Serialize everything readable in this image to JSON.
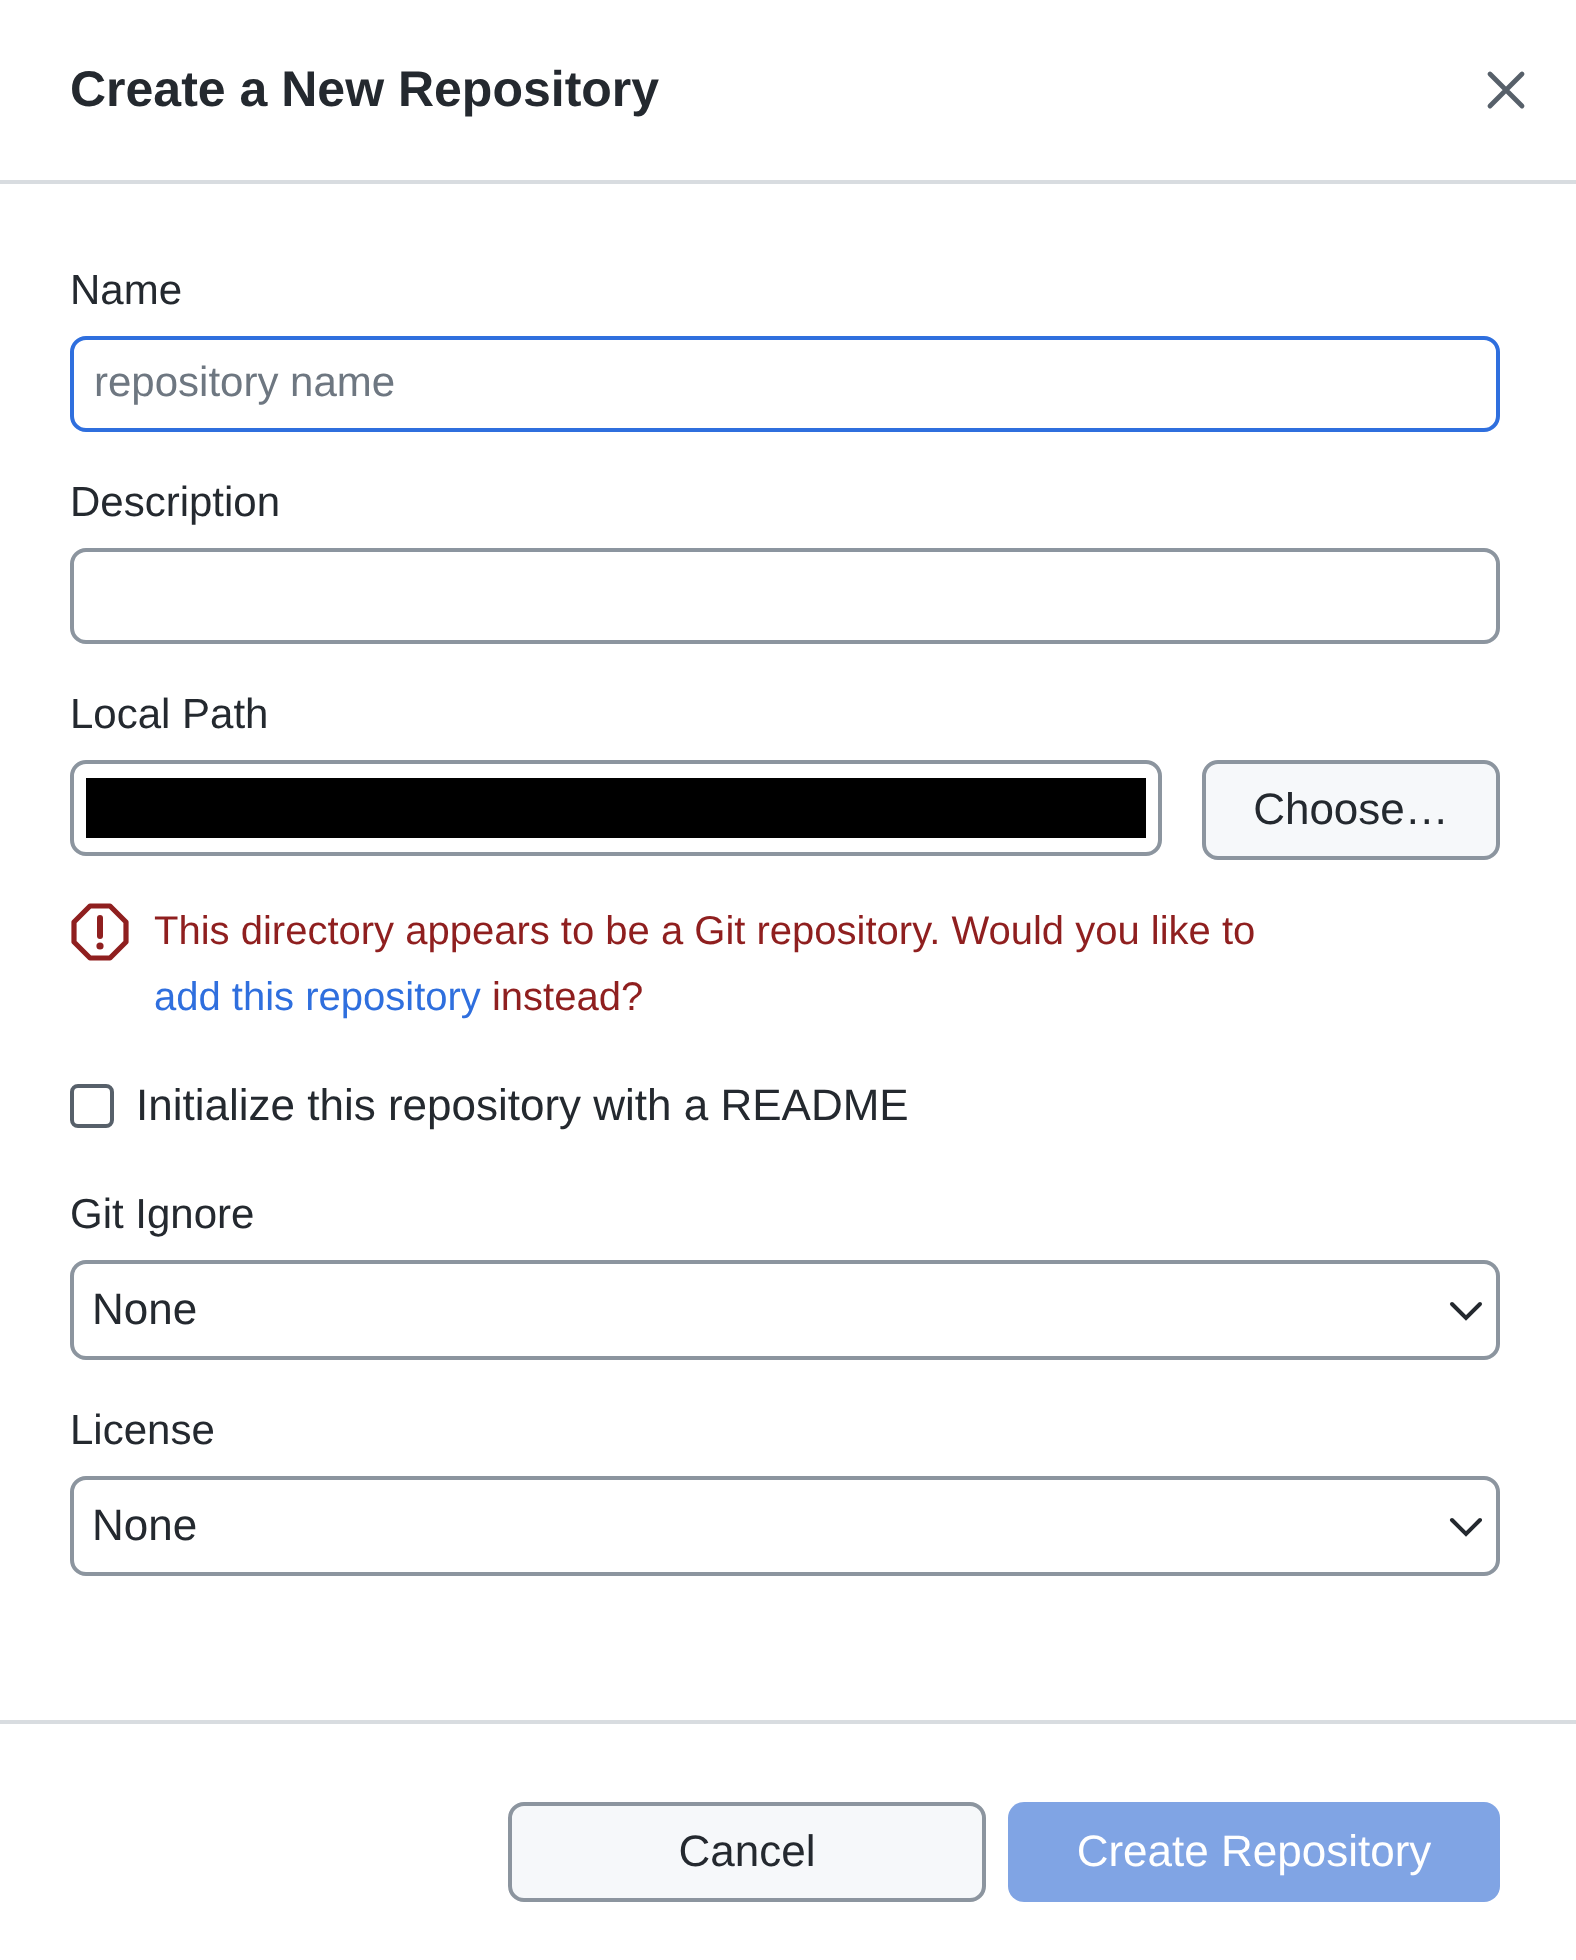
{
  "dialog": {
    "title": "Create a New Repository"
  },
  "fields": [
    {
      "label": "Name",
      "placeholder": "repository name",
      "focused": true
    },
    {
      "label": "Description",
      "focused": false
    }
  ],
  "local_path": {
    "label": "Local Path",
    "redacted": true,
    "button": "Choose…"
  },
  "warning": {
    "before": "This directory appears to be a Git repository. Would you like to ",
    "link": "add this repository",
    "after": " instead?"
  },
  "readme": {
    "label": "Initialize this repository with a README",
    "checked": false
  },
  "selects": [
    {
      "label": "Git Ignore",
      "value": "None"
    },
    {
      "label": "License",
      "value": "None"
    }
  ],
  "buttons": [
    {
      "label": "Cancel",
      "kind": "secondary",
      "disabled": false
    },
    {
      "label": "Create Repository",
      "kind": "primary",
      "disabled": true
    }
  ]
}
